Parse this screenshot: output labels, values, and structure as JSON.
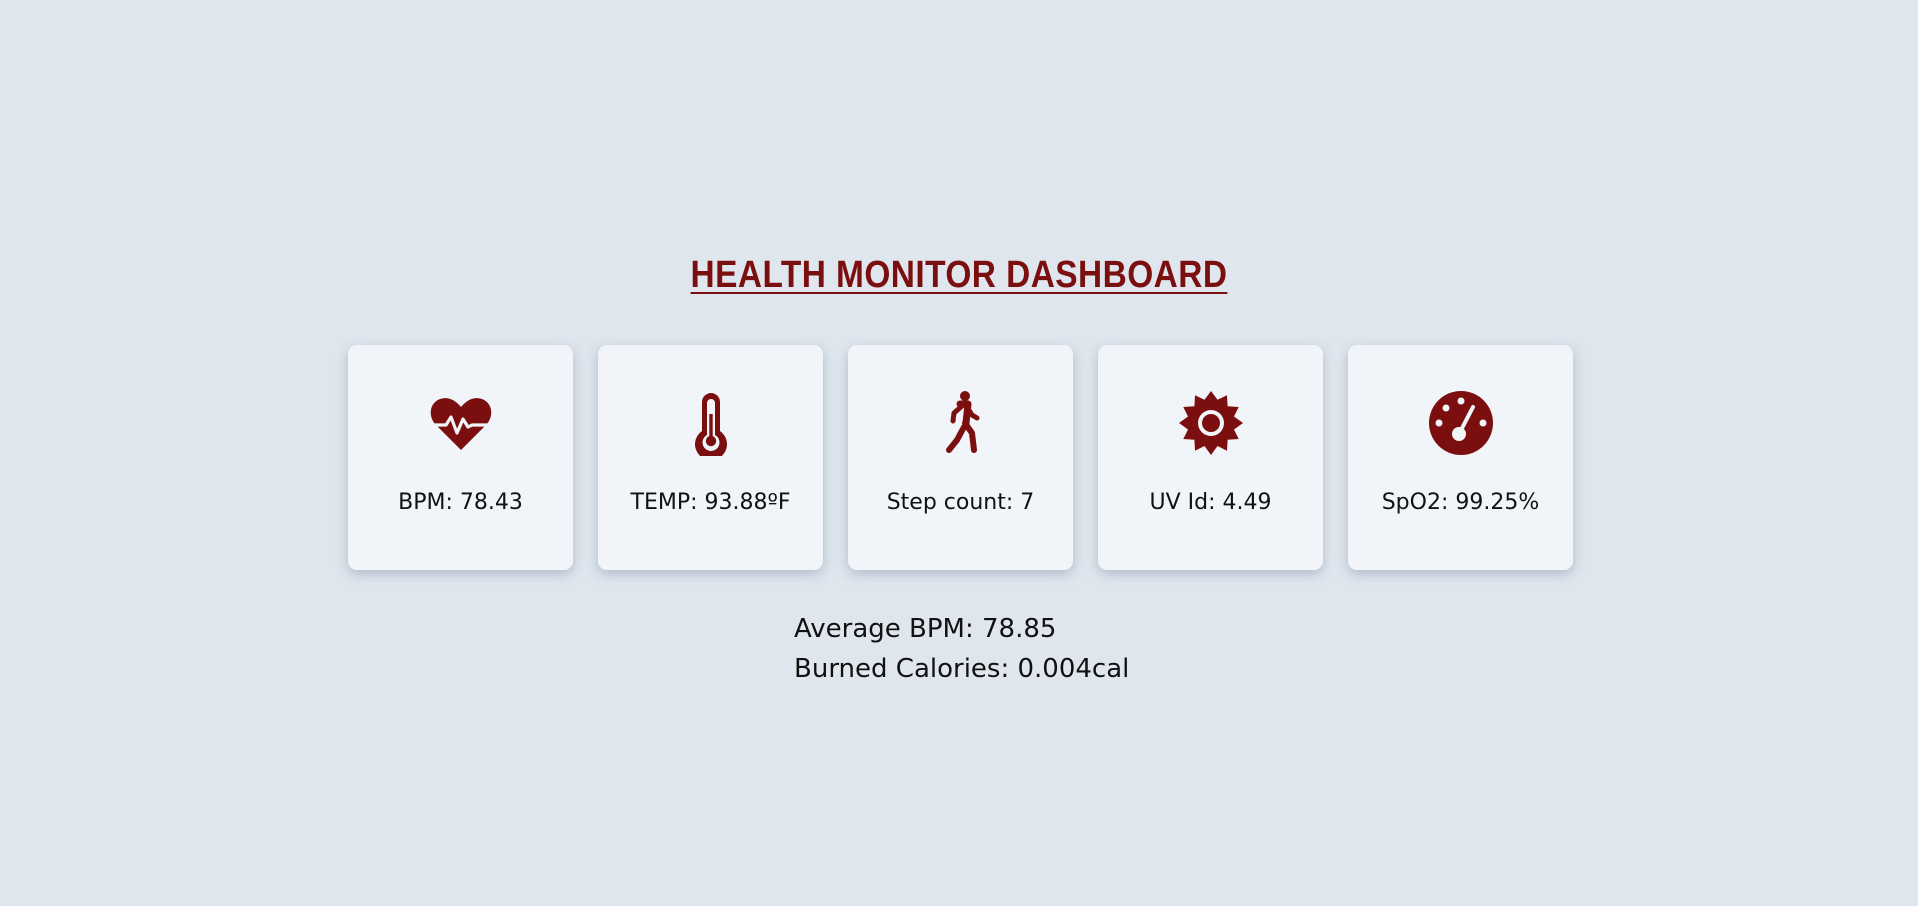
{
  "header": {
    "title": "HEALTH MONITOR DASHBOARD"
  },
  "colors": {
    "accent": "#7b0f0f",
    "background": "#dfe6ee",
    "card": "#f1f5f9"
  },
  "cards": [
    {
      "icon": "heart-pulse-icon",
      "label": "BPM: 78.43"
    },
    {
      "icon": "thermometer-icon",
      "label": "TEMP: 93.88ºF"
    },
    {
      "icon": "walking-person-icon",
      "label": "Step count: 7"
    },
    {
      "icon": "sun-icon",
      "label": "UV Id: 4.49"
    },
    {
      "icon": "gauge-icon",
      "label": "SpO2: 99.25%"
    }
  ],
  "summary": {
    "average_bpm": "Average BPM: 78.85",
    "burned_calories": "Burned Calories: 0.004cal"
  }
}
